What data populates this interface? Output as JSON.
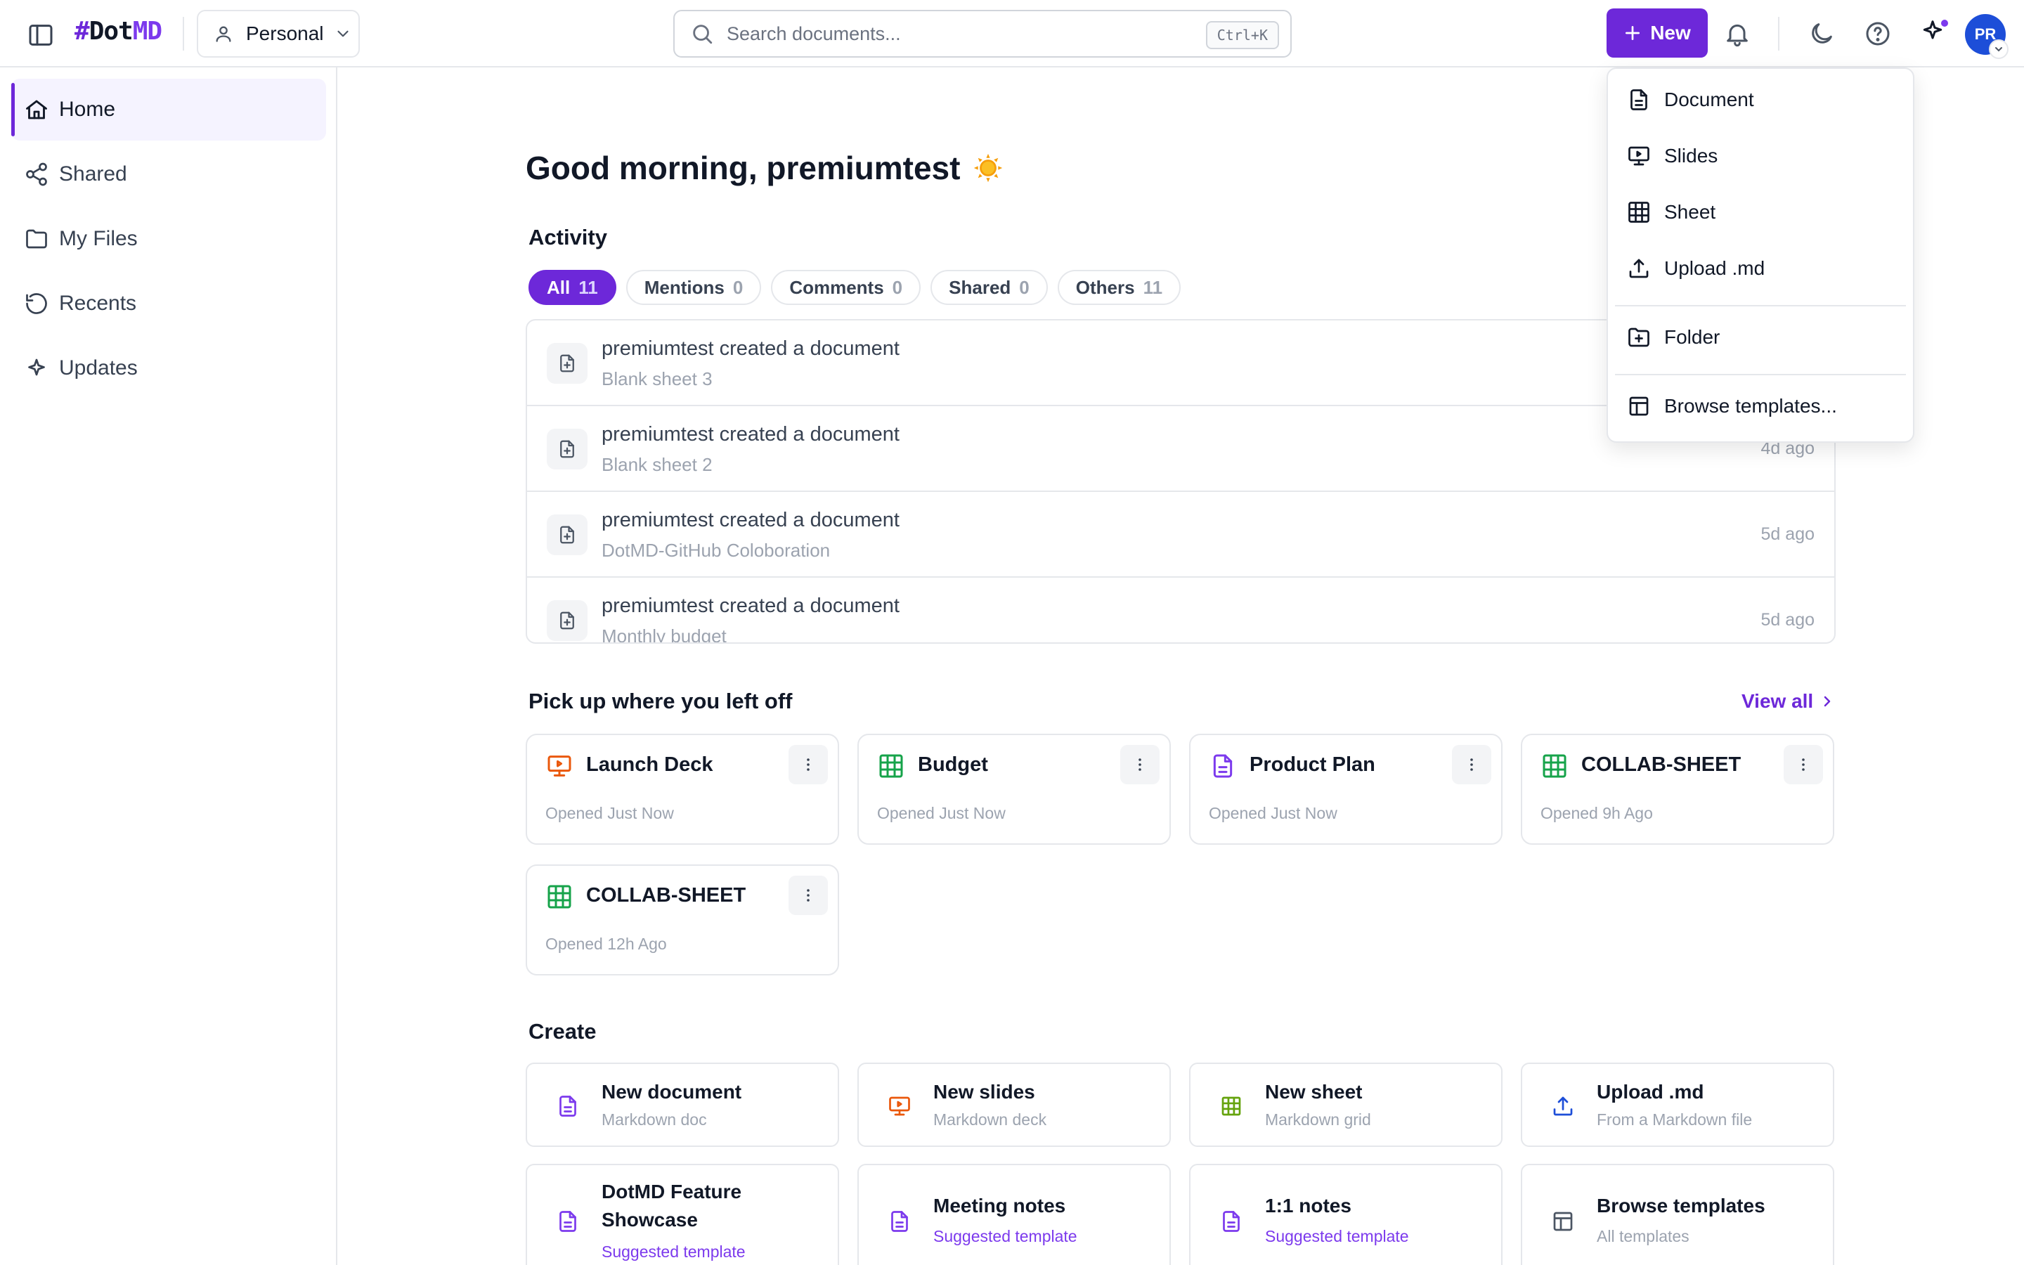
{
  "app": {
    "logo_hash": "#",
    "logo_dot": "Dot",
    "logo_md": "MD"
  },
  "topbar": {
    "workspace_label": "Personal",
    "search_placeholder": "Search documents...",
    "search_shortcut": "Ctrl+K",
    "new_label": "New",
    "avatar_initials": "PR"
  },
  "sidebar": {
    "items": [
      {
        "label": "Home",
        "icon": "home-icon",
        "active": true
      },
      {
        "label": "Shared",
        "icon": "share-icon"
      },
      {
        "label": "My Files",
        "icon": "folder-icon"
      },
      {
        "label": "Recents",
        "icon": "history-icon"
      },
      {
        "label": "Updates",
        "icon": "sparkle-icon"
      }
    ]
  },
  "main": {
    "greeting": "Good morning, premiumtest",
    "activity_title": "Activity",
    "filters": [
      {
        "label": "All",
        "count": "11",
        "active": true
      },
      {
        "label": "Mentions",
        "count": "0"
      },
      {
        "label": "Comments",
        "count": "0"
      },
      {
        "label": "Shared",
        "count": "0"
      },
      {
        "label": "Others",
        "count": "11"
      }
    ],
    "activity": [
      {
        "title": "premiumtest created a document",
        "sub": "Blank sheet 3",
        "time": ""
      },
      {
        "title": "premiumtest created a document",
        "sub": "Blank sheet 2",
        "time": "4d ago"
      },
      {
        "title": "premiumtest created a document",
        "sub": "DotMD-GitHub Coloboration",
        "time": "5d ago"
      },
      {
        "title": "premiumtest created a document",
        "sub": "Monthly budget",
        "time": "5d ago"
      }
    ],
    "recent_title": "Pick up where you left off",
    "view_all": "View all",
    "recent": [
      {
        "title": "Launch Deck",
        "sub": "Opened Just Now",
        "icon": "slides-icon"
      },
      {
        "title": "Budget",
        "sub": "Opened Just Now",
        "icon": "sheet-icon"
      },
      {
        "title": "Product Plan",
        "sub": "Opened Just Now",
        "icon": "document-icon"
      },
      {
        "title": "COLLAB-SHEET",
        "sub": "Opened 9h Ago",
        "icon": "sheet-icon"
      },
      {
        "title": "COLLAB-SHEET",
        "sub": "Opened 12h Ago",
        "icon": "sheet-icon"
      }
    ],
    "create_title": "Create",
    "create": [
      {
        "title": "New document",
        "sub": "Markdown doc",
        "icon": "document-icon"
      },
      {
        "title": "New slides",
        "sub": "Markdown deck",
        "icon": "slides-icon"
      },
      {
        "title": "New sheet",
        "sub": "Markdown grid",
        "icon": "sheet-icon"
      },
      {
        "title": "Upload .md",
        "sub": "From a Markdown file",
        "icon": "upload-icon"
      },
      {
        "title": "DotMD Feature Showcase",
        "sub": "Suggested template",
        "icon": "document-icon"
      },
      {
        "title": "Meeting notes",
        "sub": "Suggested template",
        "icon": "document-icon"
      },
      {
        "title": "1:1 notes",
        "sub": "Suggested template",
        "icon": "document-icon"
      },
      {
        "title": "Browse templates",
        "sub": "All templates",
        "icon": "template-icon"
      }
    ]
  },
  "dropdown": {
    "items": [
      {
        "label": "Document",
        "icon": "document-icon"
      },
      {
        "label": "Slides",
        "icon": "slides-icon"
      },
      {
        "label": "Sheet",
        "icon": "sheet-icon"
      },
      {
        "label": "Upload .md",
        "icon": "upload-icon"
      },
      {
        "label": "Folder",
        "icon": "folder-plus-icon"
      },
      {
        "label": "Browse templates...",
        "icon": "template-icon"
      }
    ]
  },
  "colors": {
    "accent": "#6d28d9",
    "slides": "#ea580c",
    "sheet": "#16a34a",
    "document": "#7c3aed",
    "upload": "#1d4ed8"
  }
}
